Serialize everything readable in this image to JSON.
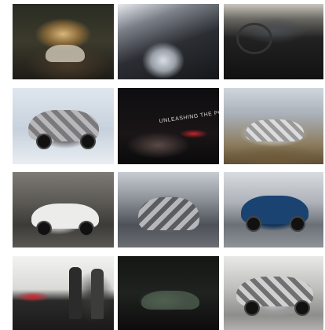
{
  "gallery": {
    "tiles": [
      {
        "id": "t1",
        "overlay": ""
      },
      {
        "id": "t2",
        "overlay": ""
      },
      {
        "id": "t3",
        "overlay": ""
      },
      {
        "id": "t4",
        "overlay": ""
      },
      {
        "id": "t5",
        "overlay": "UNLEASHING THE POWER PERFORMANCE"
      },
      {
        "id": "t6",
        "overlay": ""
      },
      {
        "id": "t7",
        "overlay": ""
      },
      {
        "id": "t8",
        "overlay": ""
      },
      {
        "id": "t9",
        "overlay": ""
      },
      {
        "id": "t10",
        "overlay": ""
      },
      {
        "id": "t11",
        "overlay": ""
      },
      {
        "id": "t12",
        "overlay": ""
      }
    ]
  },
  "colors": {
    "background": "#ffffff",
    "accent_red": "#c2262a"
  }
}
